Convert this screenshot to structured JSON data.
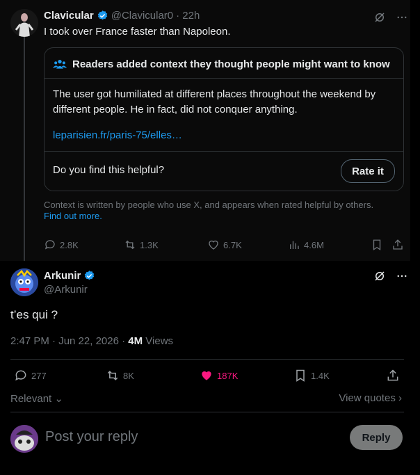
{
  "parent": {
    "name": "Clavicular",
    "handle": "@Clavicular0",
    "time": "· 22h",
    "text": "I took over France faster than Napoleon.",
    "note": {
      "header": "Readers added context they thought people might want to know",
      "body": "The user got humiliated at different places throughout the weekend by different people. He in fact, did not conquer anything.",
      "link": "leparisien.fr/paris-75/elles…",
      "question": "Do you find this helpful?",
      "rate_label": "Rate it"
    },
    "context": "Context is written by people who use X, and appears when rated helpful by others.",
    "context_link": "Find out more.",
    "actions": {
      "replies": "2.8K",
      "reposts": "1.3K",
      "likes": "6.7K",
      "views": "4.6M"
    }
  },
  "focused": {
    "name": "Arkunir",
    "handle": "@Arkunir",
    "text": "t’es qui ?",
    "timestamp": "2:47 PM · Jun 22, 2026 ·",
    "views_count": "4M",
    "views_label": "Views",
    "actions": {
      "replies": "277",
      "reposts": "8K",
      "likes": "187K",
      "bookmarks": "1.4K"
    },
    "relevant": "Relevant",
    "view_quotes": "View quotes"
  },
  "reply": {
    "placeholder": "Post your reply",
    "button": "Reply"
  },
  "colors": {
    "accent": "#1d9bf0",
    "like": "#f91880",
    "background": "#000000",
    "muted": "#71767b"
  }
}
